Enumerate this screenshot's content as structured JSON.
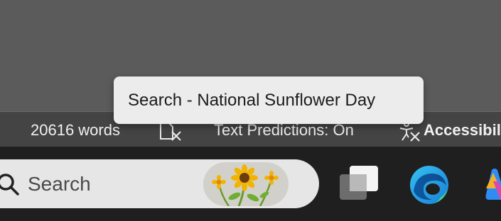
{
  "status_bar": {
    "word_count": "20616 words",
    "text_predictions": "Text Predictions: On",
    "accessibility": "Accessibility"
  },
  "tooltip": {
    "text": "Search - National Sunflower Day"
  },
  "taskbar": {
    "search_placeholder": "Search",
    "icons": [
      "search-icon",
      "sunflower-doodle",
      "task-view-icon",
      "edge-icon",
      "copilot-icon"
    ]
  },
  "colors": {
    "doc_background": "#5b5b5b",
    "status_bar": "#444444",
    "taskbar": "#1f1f1f",
    "search_box": "#e6e6e6",
    "tooltip": "#ececec",
    "sunflower_petal": "#f2b400"
  }
}
